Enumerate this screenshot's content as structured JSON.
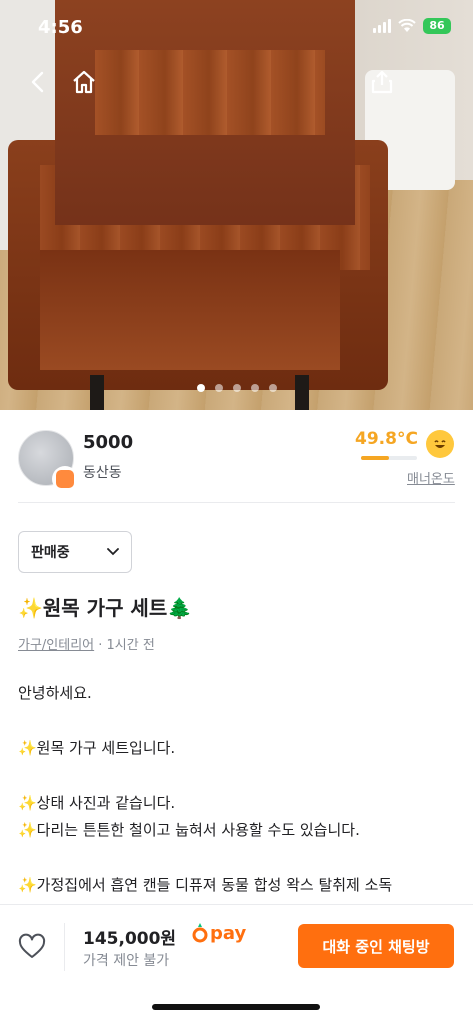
{
  "status_bar": {
    "time": "4:56",
    "battery": "86"
  },
  "carousel": {
    "total": 5,
    "active_index": 0
  },
  "seller": {
    "name": "5000",
    "location": "동산동",
    "temperature": "49.8°C",
    "temperature_level": 0.498,
    "manner_label": "매너온도"
  },
  "listing": {
    "status": "판매중",
    "title": "✨원목 가구 세트🌲",
    "category": "가구/인테리어",
    "time": " · 1시간 전",
    "description": [
      "안녕하세요.",
      "",
      "✨원목 가구 세트입니다.",
      "",
      "✨상태 사진과 같습니다.",
      "✨다리는 튼튼한 철이고 눕혀서 사용할 수도 있습니다.",
      "",
      "✨가정집에서 흡연 캔들 디퓨져 동물 합성 왁스 탈취제 소독"
    ]
  },
  "bottom_bar": {
    "price": "145,000원",
    "pay_label": "pay",
    "negotiation": "가격 제안 불가",
    "chat_button": "대화 중인 채팅방"
  },
  "colors": {
    "accent": "#ff6f0f",
    "temperature": "#f5a623",
    "battery": "#34c759"
  }
}
